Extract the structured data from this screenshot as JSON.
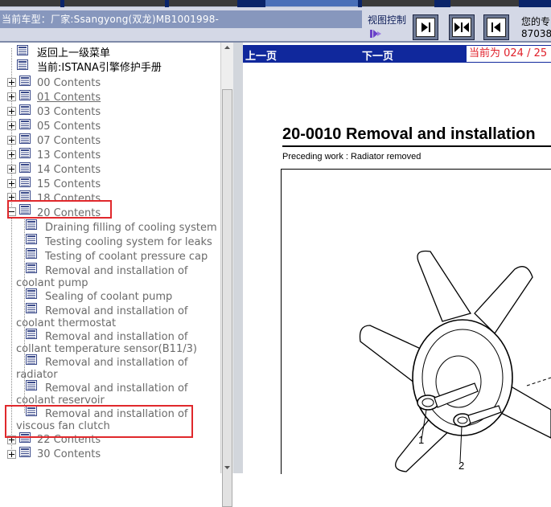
{
  "header": {
    "model_label": "当前车型：厂家:Ssangyong(双龙)MB1001998-",
    "view_control_label": "视图控制",
    "expert_line1": "您的专",
    "expert_line2": "87038"
  },
  "toc": {
    "back_label": "返回上一级菜单",
    "current_label": "当前:ISTANA引擎修护手册",
    "items": [
      {
        "label": "00 Contents"
      },
      {
        "label": "01 Contents"
      },
      {
        "label": "03 Contents"
      },
      {
        "label": "05 Contents"
      },
      {
        "label": "07 Contents"
      },
      {
        "label": "13 Contents"
      },
      {
        "label": "14 Contents"
      },
      {
        "label": "15 Contents"
      },
      {
        "label": "18 Contents"
      },
      {
        "label": "20 Contents"
      }
    ],
    "children": [
      {
        "label": "Draining filling of cooling system"
      },
      {
        "label": "Testing cooling system for leaks"
      },
      {
        "label": "Testing of coolant pressure cap"
      },
      {
        "label": "Removal and installation of coolant pump"
      },
      {
        "label": "Sealing of coolant pump"
      },
      {
        "label": "Removal and installation of coolant thermostat"
      },
      {
        "label": "Removal and installation of collant temperature sensor(B11/3)"
      },
      {
        "label": "Removal and installation of radiator"
      },
      {
        "label": "Removal and installation of coolant reservoir"
      },
      {
        "label": "Removal and installation of viscous fan clutch"
      }
    ],
    "after": [
      {
        "label": "22 Contents"
      },
      {
        "label": "30 Contents"
      }
    ]
  },
  "content": {
    "prev_label": "上一页",
    "next_label": "下一页",
    "page_indicator": "当前为 024 / 25",
    "doc_title": "20-0010  Removal and installation",
    "doc_subtitle": "Preceding work : Radiator removed",
    "callouts": [
      "1",
      "2"
    ]
  },
  "colors": {
    "nav_bar": "#10289c",
    "highlight": "#e0282c",
    "page_indicator_text": "#e0202a"
  }
}
